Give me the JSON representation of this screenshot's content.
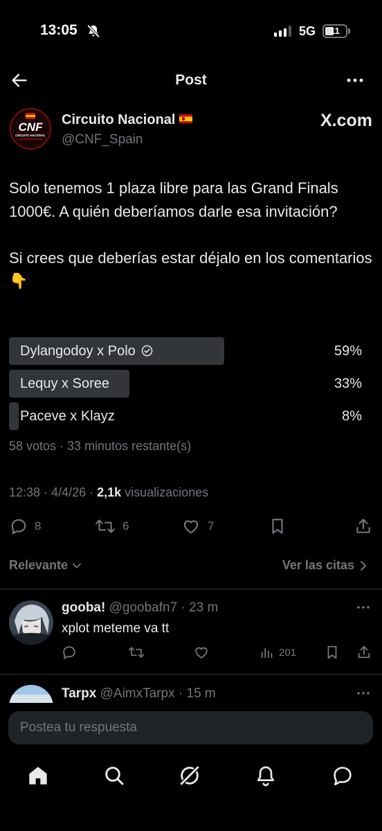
{
  "status_bar": {
    "time": "13:05",
    "network": "5G",
    "battery": "11",
    "icons": [
      "bell-slash-icon",
      "signal-icon",
      "battery-icon"
    ]
  },
  "nav": {
    "title": "Post",
    "back_icon": "arrow-left-icon",
    "more_icon": "more-horizontal-icon"
  },
  "author": {
    "name": "Circuito Nacional",
    "handle": "@CNF_Spain",
    "badge": "X.com",
    "avatar_text": "CNF",
    "avatar_subtext": "CIRCUITO NACIONAL"
  },
  "post": {
    "text": "Solo tenemos 1 plaza libre para las Grand Finals 1000€. A quién deberíamos darle esa invitación?\n\nSi crees que deberías estar déjalo en los comentarios 👇"
  },
  "poll": {
    "options": [
      {
        "label": "Dylangodoy x Polo",
        "percent_text": "59%",
        "percent": 59,
        "winner": true
      },
      {
        "label": "Lequy x Soree",
        "percent_text": "33%",
        "percent": 33,
        "winner": false
      },
      {
        "label": "Paceve x Klayz",
        "percent_text": "8%",
        "percent": 8,
        "winner": false
      }
    ],
    "meta": "58 votos · 33 minutos restante(s)"
  },
  "post_meta": {
    "time": "12:38",
    "date": "4/4/26",
    "views_count": "2,1k",
    "views_label": "visualizaciones"
  },
  "actions": {
    "replies": "8",
    "reposts": "6",
    "likes": "7"
  },
  "sort": {
    "left_label": "Relevante",
    "right_label": "Ver las citas"
  },
  "replies": [
    {
      "name": "gooba!",
      "handle": "@goobafn7",
      "time": "23 m",
      "text": "xplot meteme va tt",
      "views": "201"
    },
    {
      "name": "Tarpx",
      "handle": "@AimxTarpx",
      "time": "15 m"
    }
  ],
  "composer": {
    "placeholder": "Postea tu respuesta"
  },
  "tabbar": {
    "tabs": [
      "home-icon",
      "search-icon",
      "grok-icon",
      "notifications-icon",
      "messages-icon"
    ]
  },
  "colors": {
    "background": "#000000",
    "text": "#e7e9ea",
    "muted": "#71767b",
    "poll_bar": "#333639",
    "divider": "#2f3336",
    "composer": "#202327",
    "brand_red": "#c8101e"
  }
}
